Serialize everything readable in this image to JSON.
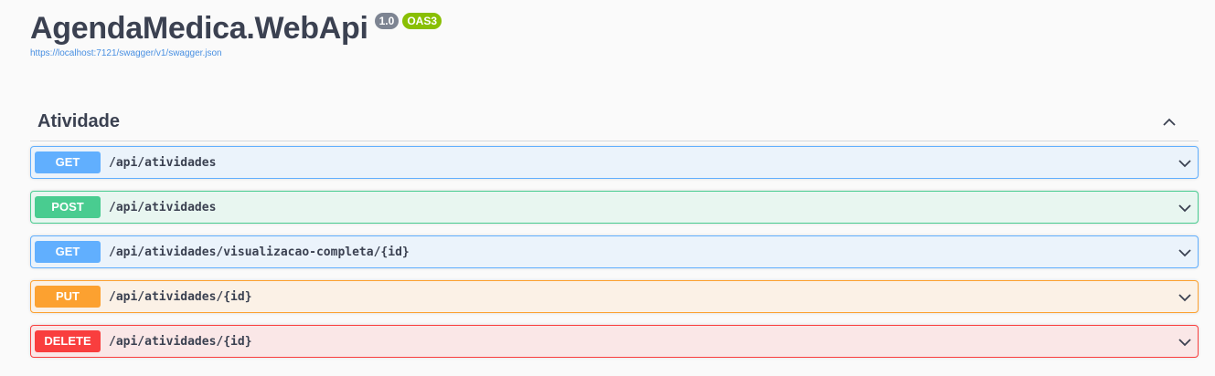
{
  "header": {
    "title": "AgendaMedica.WebApi",
    "version_badge": "1.0",
    "oas_badge": "OAS3",
    "spec_link": "https://localhost:7121/swagger/v1/swagger.json"
  },
  "tag": {
    "name": "Atividade",
    "toggle_icon": "chevron-up-icon"
  },
  "operations": [
    {
      "method": "GET",
      "path": "/api/atividades",
      "color": "#61affe"
    },
    {
      "method": "POST",
      "path": "/api/atividades",
      "color": "#49cc90"
    },
    {
      "method": "GET",
      "path": "/api/atividades/visualizacao-completa/{id}",
      "color": "#61affe"
    },
    {
      "method": "PUT",
      "path": "/api/atividades/{id}",
      "color": "#fca130"
    },
    {
      "method": "DELETE",
      "path": "/api/atividades/{id}",
      "color": "#f93e3e"
    }
  ]
}
